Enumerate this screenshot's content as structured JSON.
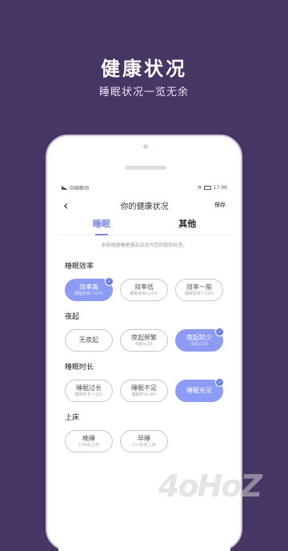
{
  "promo": {
    "title": "健康状况",
    "subtitle": "睡眠状况一览无余"
  },
  "statusbar": {
    "carrier": "中国移动",
    "time": "17:06"
  },
  "nav": {
    "back": "‹",
    "title": "你的健康状况",
    "save": "保存"
  },
  "tabs": {
    "sleep": "睡眠",
    "other": "其他"
  },
  "hint": "系统根据睡眠报告自动为您匹配的标签。",
  "sections": [
    {
      "title": "睡眠效率",
      "options": [
        {
          "label": "效率高",
          "sub": "睡眠效率＞20%",
          "selected": true
        },
        {
          "label": "效率低",
          "sub": "睡眠效率≤15%",
          "selected": false
        },
        {
          "label": "效率一般",
          "sub": "睡眠效率＞15%",
          "selected": false
        }
      ]
    },
    {
      "title": "夜起",
      "options": [
        {
          "label": "无夜起",
          "sub": "",
          "selected": false
        },
        {
          "label": "夜起频繁",
          "sub": "夜起≥3次",
          "selected": false
        },
        {
          "label": "夜起较少",
          "sub": "夜起≤2次",
          "selected": true
        }
      ]
    },
    {
      "title": "睡眠时长",
      "options": [
        {
          "label": "睡眠过长",
          "sub": "睡眠时长＞11h",
          "selected": false
        },
        {
          "label": "睡眠不足",
          "sub": "睡眠时长≤6h",
          "selected": false
        },
        {
          "label": "睡眠充足",
          "sub": "",
          "selected": true
        }
      ]
    },
    {
      "title": "上床",
      "options": [
        {
          "label": "晚睡",
          "sub": "2:00后上床",
          "selected": false
        },
        {
          "label": "早睡",
          "sub": "21:00前上床",
          "selected": false
        }
      ]
    }
  ],
  "watermark": "4oHoZ"
}
